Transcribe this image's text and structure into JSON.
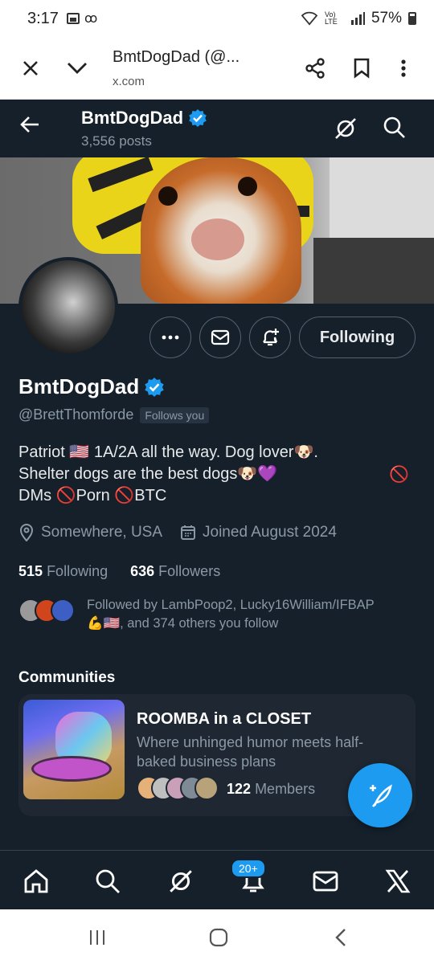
{
  "status_bar": {
    "time": "3:17",
    "battery": "57%",
    "network": "Vo) LTE"
  },
  "browser": {
    "page_title": "BmtDogDad (@...",
    "url": "x.com"
  },
  "header": {
    "name": "BmtDogDad",
    "posts": "3,556 posts"
  },
  "profile": {
    "display_name": "BmtDogDad",
    "handle": "@BrettThomforde",
    "follows_you": "Follows you",
    "following_button": "Following",
    "bio_line1": "Patriot 🇺🇸 1A/2A all the way. Dog lover🐶.",
    "bio_line2": "Shelter dogs are the best dogs🐶💜",
    "bio_line2_trailing": "🚫",
    "bio_line3": "DMs 🚫Porn 🚫BTC",
    "location": "Somewhere, USA",
    "joined": "Joined August 2024",
    "following_count": "515",
    "following_label": "Following",
    "followers_count": "636",
    "followers_label": "Followers",
    "followed_by_line1": "Followed by LambPoop2, Lucky16William/IFBAP",
    "followed_by_line2": "💪🇺🇸, and 374 others you follow"
  },
  "communities": {
    "title": "Communities",
    "items": [
      {
        "name": "ROOMBA in a CLOSET",
        "description": "Where unhinged humor meets half-baked business plans",
        "member_count": "122",
        "member_label": "Members"
      }
    ]
  },
  "bottom_nav": {
    "notifications_badge": "20+"
  },
  "colors": {
    "background": "#15202b",
    "accent": "#1d9bf0",
    "verified": "#1d9bf0",
    "secondary_text": "#8b98a5"
  }
}
